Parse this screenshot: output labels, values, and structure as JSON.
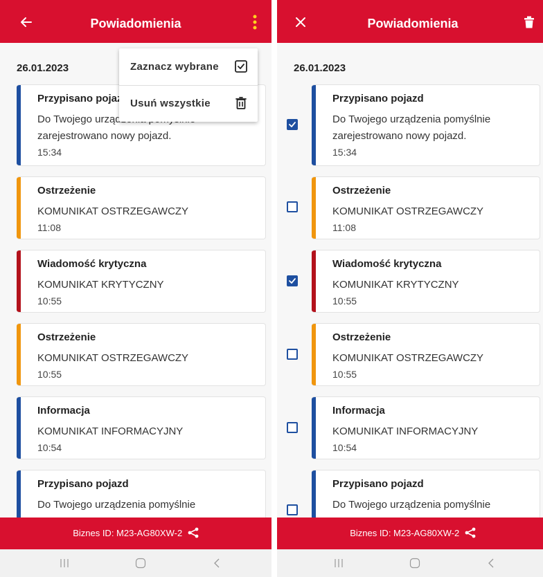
{
  "header": {
    "title": "Powiadomienia"
  },
  "date_group": "26.01.2023",
  "menu": {
    "mark_selected": "Zaznacz wybrane",
    "delete_all": "Usuń wszystkie"
  },
  "notifications": [
    {
      "title": "Przypisano pojazd",
      "body": "Do Twojego urządzenia pomyślnie zarejestrowano nowy pojazd.",
      "time": "15:34",
      "color": "#1e4fa0",
      "selected": true
    },
    {
      "title": "Ostrzeżenie",
      "body": "KOMUNIKAT OSTRZEGAWCZY",
      "time": "11:08",
      "color": "#f0960e",
      "selected": false
    },
    {
      "title": "Wiadomość krytyczna",
      "body": "KOMUNIKAT KRYTYCZNY",
      "time": "10:55",
      "color": "#b3121c",
      "selected": true
    },
    {
      "title": "Ostrzeżenie",
      "body": "KOMUNIKAT OSTRZEGAWCZY",
      "time": "10:55",
      "color": "#f0960e",
      "selected": false
    },
    {
      "title": "Informacja",
      "body": "KOMUNIKAT INFORMACYJNY",
      "time": "10:54",
      "color": "#1e4fa0",
      "selected": false
    },
    {
      "title": "Przypisano pojazd",
      "body": "Do Twojego urządzenia pomyślnie",
      "time": "",
      "color": "#1e4fa0",
      "selected": false
    }
  ],
  "footer": {
    "biznes_id": "Biznes ID:  M23-AG80XW-2"
  },
  "icons": {
    "back": "arrow-left-icon",
    "more": "more-vertical-icon",
    "close": "close-icon",
    "trash": "trash-icon",
    "share": "share-icon",
    "checkbox": "checkbox-check-icon"
  },
  "colors": {
    "brand_red": "#d8102f",
    "info_blue": "#1e4fa0",
    "warning_orange": "#f0960e",
    "critical_red": "#b3121c"
  }
}
